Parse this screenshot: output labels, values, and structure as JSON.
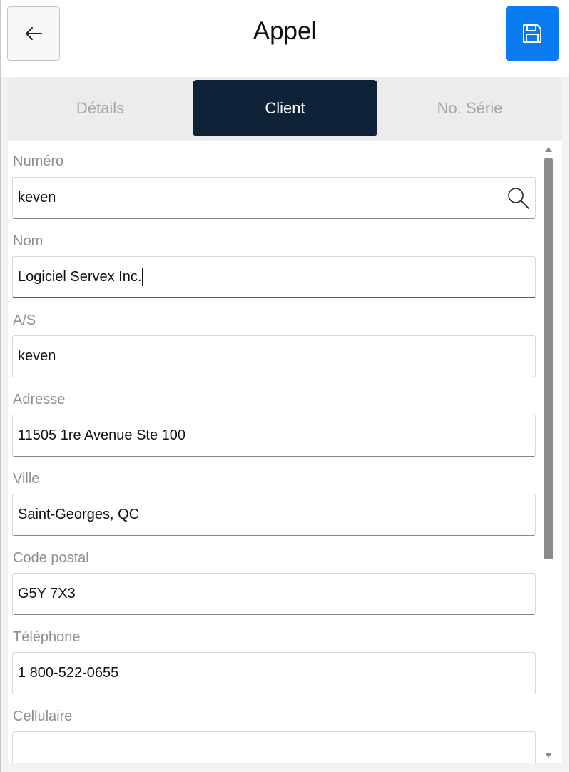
{
  "header": {
    "title": "Appel",
    "back_icon": "arrow-left-icon",
    "save_icon": "floppy-disk-icon",
    "accent": "#0a7cf2"
  },
  "tabs": [
    {
      "label": "Détails",
      "active": false
    },
    {
      "label": "Client",
      "active": true
    },
    {
      "label": "No. Série",
      "active": false
    }
  ],
  "form": {
    "numero": {
      "label": "Numéro",
      "value": "keven"
    },
    "nom": {
      "label": "Nom",
      "value": "Logiciel Servex Inc."
    },
    "as": {
      "label": "A/S",
      "value": "keven"
    },
    "adresse": {
      "label": "Adresse",
      "value": "11505 1re Avenue Ste 100"
    },
    "ville": {
      "label": "Ville",
      "value": "Saint-Georges, QC"
    },
    "code_postal": {
      "label": "Code postal",
      "value": "G5Y 7X3"
    },
    "telephone": {
      "label": "Téléphone",
      "value": "1 800-522-0655"
    },
    "cellulaire": {
      "label": "Cellulaire",
      "value": ""
    }
  },
  "colors": {
    "tab_active_bg": "#0e2237",
    "focus_underline": "#1a6fc4"
  }
}
